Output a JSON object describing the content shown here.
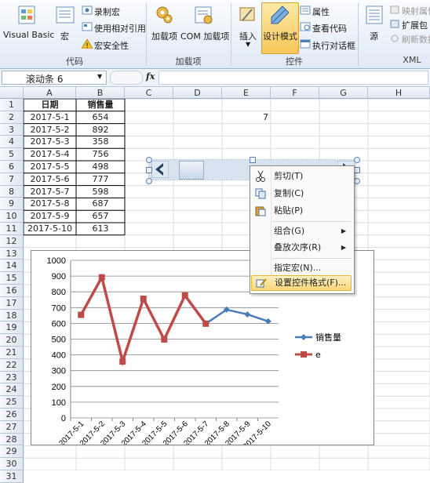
{
  "ribbon": {
    "code_group": {
      "label": "代码",
      "visual_basic": "Visual Basic",
      "macro": "宏",
      "record_macro": "录制宏",
      "relative_ref": "使用相对引用",
      "macro_security": "宏安全性"
    },
    "addins_group": {
      "label": "加载项",
      "addins": "加载项",
      "com_addins": "COM 加载项"
    },
    "controls_group": {
      "label": "控件",
      "insert": "插入",
      "design_mode": "设计模式",
      "properties": "属性",
      "view_code": "查看代码",
      "run_dialog": "执行对话框"
    },
    "xml_group": {
      "label": "XML",
      "source": "源",
      "map_props": "映射属性",
      "expansion": "扩展包",
      "refresh": "刷新数据"
    }
  },
  "formula_bar": {
    "name_box": "滚动条 6",
    "fx": "fx",
    "formula": ""
  },
  "sheet": {
    "columns": [
      "A",
      "B",
      "C",
      "D",
      "E",
      "F",
      "G",
      "H"
    ],
    "rows": [
      "1",
      "2",
      "3",
      "4",
      "5",
      "6",
      "7",
      "8",
      "9",
      "10",
      "11",
      "12",
      "13",
      "14",
      "15",
      "16",
      "17",
      "18",
      "19",
      "20",
      "21",
      "22",
      "23",
      "24",
      "25",
      "26",
      "27",
      "28",
      "29",
      "30",
      "31"
    ],
    "header": {
      "date": "日期",
      "sales": "销售量"
    },
    "data": [
      {
        "date": "2017-5-1",
        "sales": "654"
      },
      {
        "date": "2017-5-2",
        "sales": "892"
      },
      {
        "date": "2017-5-3",
        "sales": "358"
      },
      {
        "date": "2017-5-4",
        "sales": "756"
      },
      {
        "date": "2017-5-5",
        "sales": "498"
      },
      {
        "date": "2017-5-6",
        "sales": "777"
      },
      {
        "date": "2017-5-7",
        "sales": "598"
      },
      {
        "date": "2017-5-8",
        "sales": "687"
      },
      {
        "date": "2017-5-9",
        "sales": "657"
      },
      {
        "date": "2017-5-10",
        "sales": "613"
      }
    ],
    "e2_value": "7"
  },
  "context_menu": {
    "cut": "剪切(T)",
    "copy": "复制(C)",
    "paste": "粘贴(P)",
    "group": "组合(G)",
    "order": "叠放次序(R)",
    "assign_macro": "指定宏(N)...",
    "format_control": "设置控件格式(F)..."
  },
  "colors": {
    "series1": "#4a7ebb",
    "series2": "#be4b48",
    "highlight": "#fbe69a"
  },
  "chart_data": {
    "type": "line",
    "categories": [
      "2017-5-1",
      "2017-5-2",
      "2017-5-3",
      "2017-5-4",
      "2017-5-5",
      "2017-5-6",
      "2017-5-7",
      "2017-5-8",
      "2017-5-9",
      "2017-5-10"
    ],
    "series": [
      {
        "name": "销售量",
        "values": [
          654,
          892,
          358,
          756,
          498,
          777,
          598,
          687,
          657,
          613
        ]
      },
      {
        "name": "e",
        "values": [
          654,
          892,
          358,
          756,
          498,
          777,
          598,
          null,
          null,
          null
        ]
      }
    ],
    "yticks": [
      "0",
      "100",
      "200",
      "300",
      "400",
      "500",
      "600",
      "700",
      "800",
      "900",
      "1000"
    ],
    "ylim": [
      0,
      1000
    ],
    "grid": true,
    "legend": "right"
  }
}
